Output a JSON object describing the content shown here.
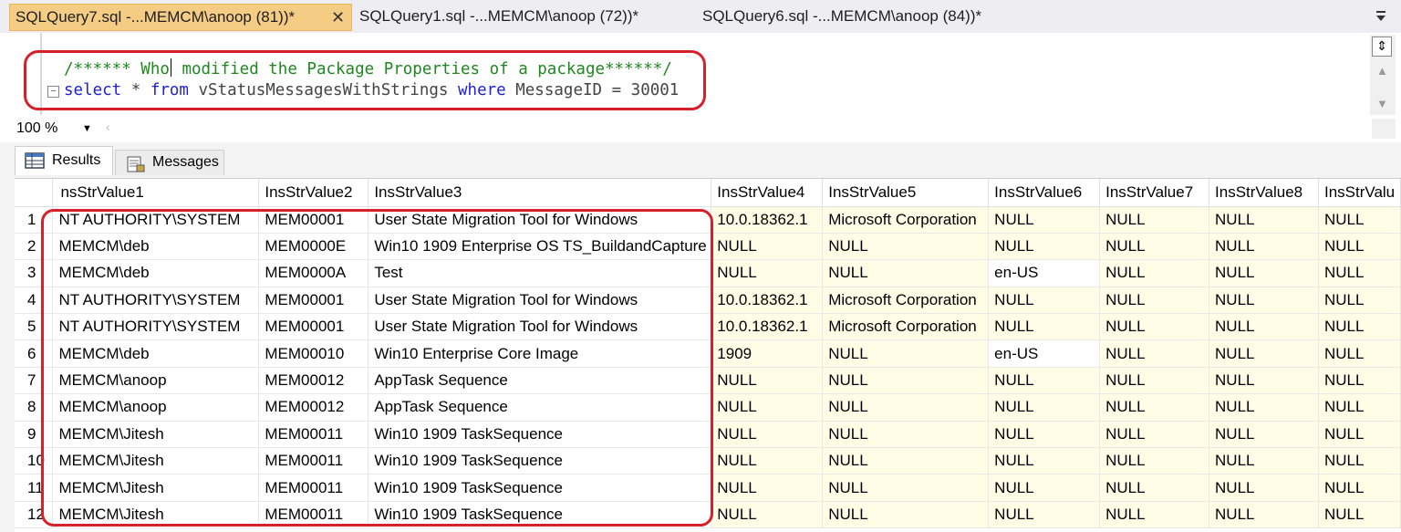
{
  "tabs": [
    {
      "label": "SQLQuery7.sql -...MEMCM\\anoop (81))*",
      "active": true
    },
    {
      "label": "SQLQuery1.sql -...MEMCM\\anoop (72))*",
      "active": false
    },
    {
      "label": "SQLQuery6.sql -...MEMCM\\anoop (84))*",
      "active": false
    }
  ],
  "editor": {
    "comment": "/****** Who modified the Package Properties of a package******/",
    "comment_part1": "/****** Who",
    "comment_part2": " modified the Package Properties of a package******/",
    "sql_select": "select",
    "sql_mid1": " * ",
    "sql_from": "from",
    "sql_view": " vStatusMessagesWithStrings ",
    "sql_where": "where",
    "sql_rest": " MessageID = 30001"
  },
  "zoom": "100 %",
  "result_tabs": {
    "results": "Results",
    "messages": "Messages"
  },
  "grid": {
    "columns": [
      "nsStrValue1",
      "InsStrValue2",
      "InsStrValue3",
      "InsStrValue4",
      "InsStrValue5",
      "InsStrValue6",
      "InsStrValue7",
      "InsStrValue8",
      "InsStrValu"
    ],
    "rows": [
      [
        "1",
        "NT AUTHORITY\\SYSTEM",
        "MEM00001",
        "User State Migration Tool for Windows",
        "10.0.18362.1",
        "Microsoft Corporation",
        "NULL",
        "NULL",
        "NULL",
        "NULL"
      ],
      [
        "2",
        "MEMCM\\deb",
        "MEM0000E",
        "Win10 1909 Enterprise OS TS_BuildandCapture",
        "NULL",
        "NULL",
        "NULL",
        "NULL",
        "NULL",
        "NULL"
      ],
      [
        "3",
        "MEMCM\\deb",
        "MEM0000A",
        "Test",
        "NULL",
        "NULL",
        "en-US",
        "NULL",
        "NULL",
        "NULL"
      ],
      [
        "4",
        "NT AUTHORITY\\SYSTEM",
        "MEM00001",
        "User State Migration Tool for Windows",
        "10.0.18362.1",
        "Microsoft Corporation",
        "NULL",
        "NULL",
        "NULL",
        "NULL"
      ],
      [
        "5",
        "NT AUTHORITY\\SYSTEM",
        "MEM00001",
        "User State Migration Tool for Windows",
        "10.0.18362.1",
        "Microsoft Corporation",
        "NULL",
        "NULL",
        "NULL",
        "NULL"
      ],
      [
        "6",
        "MEMCM\\deb",
        "MEM00010",
        "Win10 Enterprise Core Image",
        "1909",
        "NULL",
        "en-US",
        "NULL",
        "NULL",
        "NULL"
      ],
      [
        "7",
        "MEMCM\\anoop",
        "MEM00012",
        "AppTask Sequence",
        "NULL",
        "NULL",
        "NULL",
        "NULL",
        "NULL",
        "NULL"
      ],
      [
        "8",
        "MEMCM\\anoop",
        "MEM00012",
        "AppTask Sequence",
        "NULL",
        "NULL",
        "NULL",
        "NULL",
        "NULL",
        "NULL"
      ],
      [
        "9",
        "MEMCM\\Jitesh",
        "MEM00011",
        "Win10 1909 TaskSequence",
        "NULL",
        "NULL",
        "NULL",
        "NULL",
        "NULL",
        "NULL"
      ],
      [
        "10",
        "MEMCM\\Jitesh",
        "MEM00011",
        "Win10 1909 TaskSequence",
        "NULL",
        "NULL",
        "NULL",
        "NULL",
        "NULL",
        "NULL"
      ],
      [
        "11",
        "MEMCM\\Jitesh",
        "MEM00011",
        "Win10 1909 TaskSequence",
        "NULL",
        "NULL",
        "NULL",
        "NULL",
        "NULL",
        "NULL"
      ],
      [
        "12",
        "MEMCM\\Jitesh",
        "MEM00011",
        "Win10 1909 TaskSequence",
        "NULL",
        "NULL",
        "NULL",
        "NULL",
        "NULL",
        "NULL"
      ]
    ]
  },
  "colors": {
    "highlight": "#d6202a",
    "active_tab": "#f5cc84",
    "keyword": "#1f1fd6",
    "comment": "#208820"
  }
}
